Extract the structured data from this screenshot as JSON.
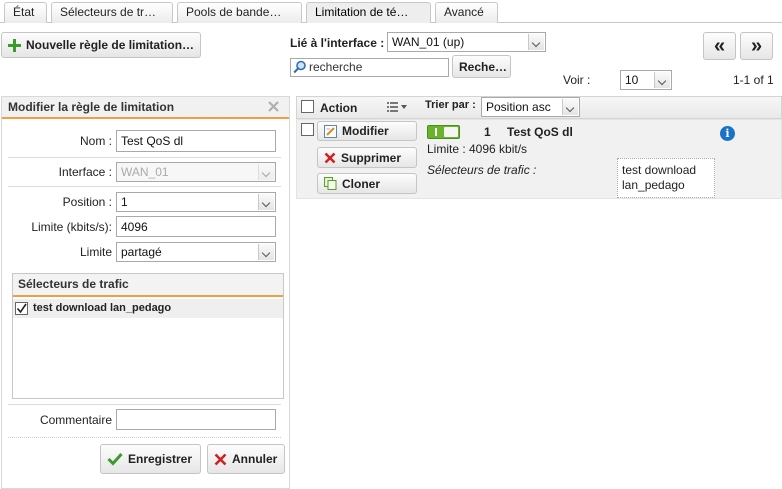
{
  "tabs": [
    "État",
    "Sélecteurs de tr…",
    "Pools de bande…",
    "Limitation de té…",
    "Avancé"
  ],
  "toolbar": {
    "new_rule_label": "Nouvelle règle de limitation…",
    "bound_label": "Lié à l'interface :",
    "interface_value": "WAN_01 (up)",
    "search_placeholder": "recherche",
    "search_button": "Reche…",
    "prev_page": "«",
    "next_page": "»",
    "show_label": "Voir :",
    "show_value": "10",
    "range": "1-1 of 1"
  },
  "form": {
    "title": "Modifier la règle de limitation",
    "name_label": "Nom :",
    "name_value": "Test QoS dl",
    "interface_label": "Interface :",
    "interface_value": "WAN_01",
    "position_label": "Position :",
    "position_value": "1",
    "limit_kbits_label": "Limite (kbits/s):",
    "limit_kbits_value": "4096",
    "limit_label": "Limite",
    "limit_value": "partagé",
    "selectors_title": "Sélecteurs de trafic",
    "selector_item": "test download lan_pedago",
    "comment_label": "Commentaire",
    "comment_value": "",
    "save_label": "Enregistrer",
    "cancel_label": "Annuler"
  },
  "list": {
    "action_header": "Action",
    "sort_label": "Trier par :",
    "sort_value": "Position asc",
    "modify_label": "Modifier",
    "delete_label": "Supprimer",
    "clone_label": "Cloner",
    "rule_position": "1",
    "rule_name": "Test QoS dl",
    "rule_limit": "Limite : 4096 kbit/s",
    "rule_selectors_label": "Sélecteurs de trafic :",
    "rule_selectors_value": "test download lan_pedago"
  },
  "colors": {
    "accent_orange": "#f0a040",
    "toggle_green": "#6ab42c",
    "info_blue": "#1a73c8",
    "plus_green": "#3a9a2a",
    "delete_red": "#cc2222"
  },
  "icons": {
    "new_rule": "plus-icon",
    "close": "close-icon",
    "search": "search-icon",
    "modify": "edit-icon",
    "delete": "delete-icon",
    "clone": "clone-icon",
    "save": "checkmark-icon",
    "cancel": "cross-icon",
    "info": "info-icon"
  }
}
